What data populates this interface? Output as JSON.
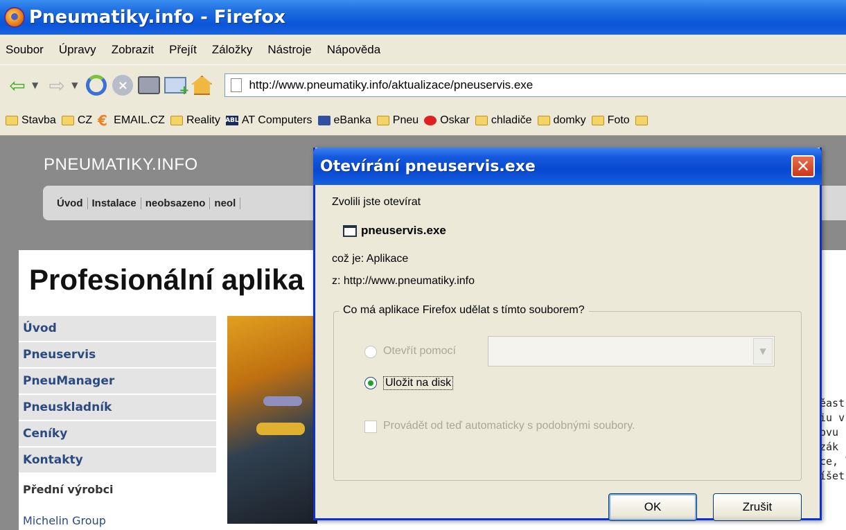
{
  "window": {
    "title": "Pneumatiky.info - Firefox"
  },
  "menu": [
    "Soubor",
    "Úpravy",
    "Zobrazit",
    "Přejít",
    "Záložky",
    "Nástroje",
    "Nápověda"
  ],
  "navigation": {
    "url": "http://www.pneumatiky.info/aktualizace/pneuservis.exe"
  },
  "bookmarks": [
    {
      "label": "Stavba",
      "icon": "folder-icon"
    },
    {
      "label": "CZ",
      "icon": "folder-icon"
    },
    {
      "label": "EMAIL.CZ",
      "icon": "email-icon"
    },
    {
      "label": "Reality",
      "icon": "folder-icon"
    },
    {
      "label": "AT Computers",
      "icon": "at-icon"
    },
    {
      "label": "eBanka",
      "icon": "ebanka-icon"
    },
    {
      "label": "Pneu",
      "icon": "folder-icon"
    },
    {
      "label": "Oskar",
      "icon": "oskar-icon"
    },
    {
      "label": "chladiče",
      "icon": "folder-icon"
    },
    {
      "label": "domky",
      "icon": "folder-icon"
    },
    {
      "label": "Foto",
      "icon": "folder-icon"
    }
  ],
  "site": {
    "title": "PNEUMATIKY.INFO",
    "tabs": [
      "Úvod",
      "Instalace",
      "neobsazeno",
      "neol"
    ],
    "heading": "Profesionální aplika",
    "sidebar": [
      "Úvod",
      "Pneuservis",
      "PneuManager",
      "Pneuskladník",
      "Ceníky",
      "Kontakty"
    ],
    "sidebar_section": "Přední výrobci",
    "sidebar_link": "Michelin Group",
    "side_text": [
      "ěast",
      "iu v",
      "ovu",
      "zák",
      "ce, l",
      "íšet"
    ]
  },
  "dialog": {
    "title": "Otevírání pneuservis.exe",
    "intro": "Zvolili jste otevírat",
    "filename": "pneuservis.exe",
    "type_line": "což je:  Aplikace",
    "from_line": "z:  http://www.pneumatiky.info",
    "question": "Co má aplikace Firefox udělat s tímto souborem?",
    "open_with_label": "Otevřít pomocí",
    "save_label": "Uložit na disk",
    "auto_label": "Provádět od teď automaticky s podobnými soubory.",
    "ok_label": "OK",
    "cancel_label": "Zrušit",
    "close_glyph": "✕"
  }
}
